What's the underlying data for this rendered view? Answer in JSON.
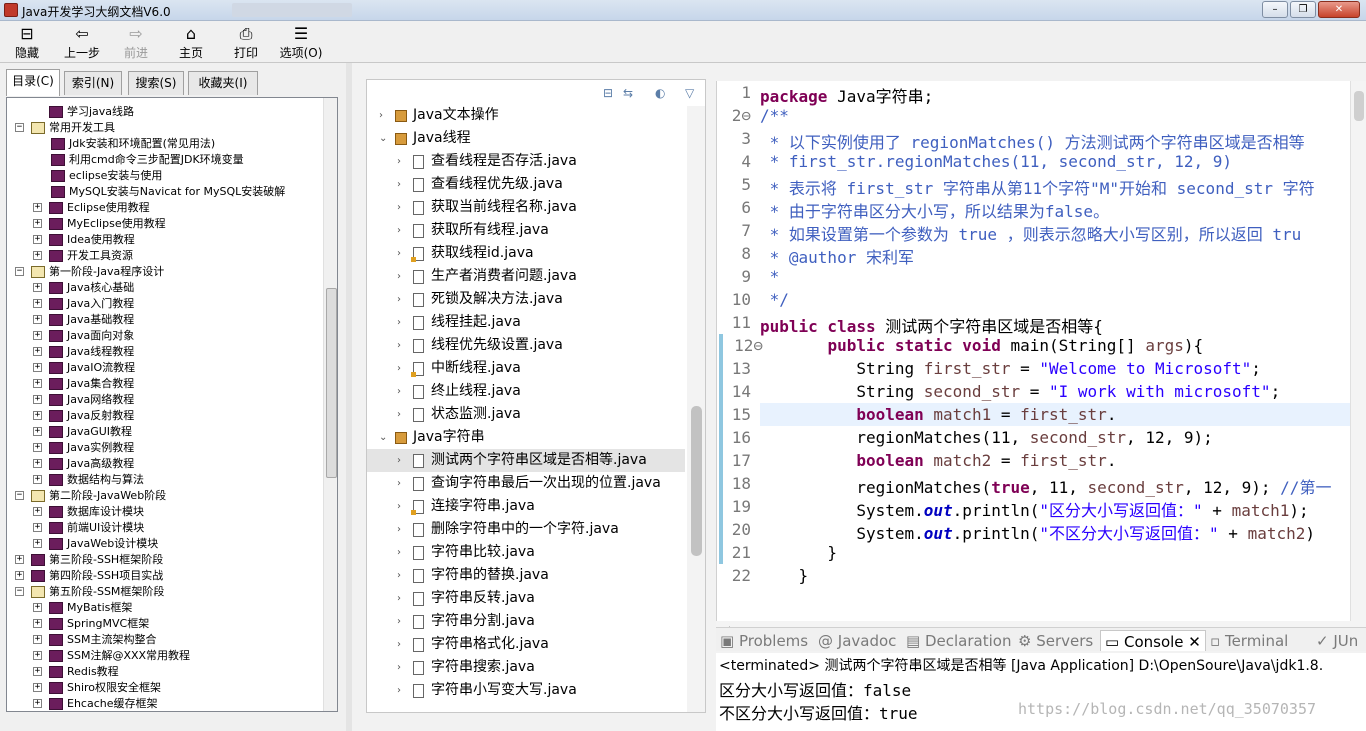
{
  "window": {
    "title": "Java开发学习大纲文档V6.0",
    "controls": [
      "–",
      "❐",
      "✕"
    ]
  },
  "toolbar": {
    "hide": "隐藏",
    "back": "上一步",
    "forward": "前进",
    "home": "主页",
    "print": "打印",
    "options": "选项(O)"
  },
  "left_tabs": [
    "目录(C)",
    "索引(N)",
    "搜索(S)",
    "收藏夹(I)"
  ],
  "toc": [
    {
      "label": "学习java线路",
      "level": 1,
      "expander": "",
      "icon": "closed"
    },
    {
      "label": "常用开发工具",
      "level": 0,
      "expander": "−",
      "icon": "open"
    },
    {
      "label": "Jdk安装和环境配置(常见用法)",
      "level": 2,
      "expander": "",
      "icon": "closed"
    },
    {
      "label": "利用cmd命令三步配置JDK环境变量",
      "level": 2,
      "expander": "",
      "icon": "closed"
    },
    {
      "label": "eclipse安装与使用",
      "level": 2,
      "expander": "",
      "icon": "closed"
    },
    {
      "label": "MySQL安装与Navicat for MySQL安装破解",
      "level": 2,
      "expander": "",
      "icon": "closed"
    },
    {
      "label": "Eclipse使用教程",
      "level": 1,
      "expander": "+",
      "icon": "closed"
    },
    {
      "label": "MyEclipse使用教程",
      "level": 1,
      "expander": "+",
      "icon": "closed"
    },
    {
      "label": "Idea使用教程",
      "level": 1,
      "expander": "+",
      "icon": "closed"
    },
    {
      "label": "开发工具资源",
      "level": 1,
      "expander": "+",
      "icon": "closed"
    },
    {
      "label": "第一阶段-Java程序设计",
      "level": 0,
      "expander": "−",
      "icon": "open"
    },
    {
      "label": "Java核心基础",
      "level": 1,
      "expander": "+",
      "icon": "closed"
    },
    {
      "label": "Java入门教程",
      "level": 1,
      "expander": "+",
      "icon": "closed"
    },
    {
      "label": "Java基础教程",
      "level": 1,
      "expander": "+",
      "icon": "closed"
    },
    {
      "label": "Java面向对象",
      "level": 1,
      "expander": "+",
      "icon": "closed"
    },
    {
      "label": "Java线程教程",
      "level": 1,
      "expander": "+",
      "icon": "closed"
    },
    {
      "label": "JavaIO流教程",
      "level": 1,
      "expander": "+",
      "icon": "closed"
    },
    {
      "label": "Java集合教程",
      "level": 1,
      "expander": "+",
      "icon": "closed"
    },
    {
      "label": "Java网络教程",
      "level": 1,
      "expander": "+",
      "icon": "closed"
    },
    {
      "label": "Java反射教程",
      "level": 1,
      "expander": "+",
      "icon": "closed"
    },
    {
      "label": "JavaGUI教程",
      "level": 1,
      "expander": "+",
      "icon": "closed"
    },
    {
      "label": "Java实例教程",
      "level": 1,
      "expander": "+",
      "icon": "closed"
    },
    {
      "label": "Java高级教程",
      "level": 1,
      "expander": "+",
      "icon": "closed"
    },
    {
      "label": "数据结构与算法",
      "level": 1,
      "expander": "+",
      "icon": "closed"
    },
    {
      "label": "第二阶段-JavaWeb阶段",
      "level": 0,
      "expander": "−",
      "icon": "open"
    },
    {
      "label": "数据库设计模块",
      "level": 1,
      "expander": "+",
      "icon": "closed"
    },
    {
      "label": "前端UI设计模块",
      "level": 1,
      "expander": "+",
      "icon": "closed"
    },
    {
      "label": "JavaWeb设计模块",
      "level": 1,
      "expander": "+",
      "icon": "closed"
    },
    {
      "label": "第三阶段-SSH框架阶段",
      "level": 0,
      "expander": "+",
      "icon": "closed"
    },
    {
      "label": "第四阶段-SSH项目实战",
      "level": 0,
      "expander": "+",
      "icon": "closed"
    },
    {
      "label": "第五阶段-SSM框架阶段",
      "level": 0,
      "expander": "−",
      "icon": "open"
    },
    {
      "label": "MyBatis框架",
      "level": 1,
      "expander": "+",
      "icon": "closed"
    },
    {
      "label": "SpringMVC框架",
      "level": 1,
      "expander": "+",
      "icon": "closed"
    },
    {
      "label": "SSM主流架构整合",
      "level": 1,
      "expander": "+",
      "icon": "closed"
    },
    {
      "label": "SSM注解@XXX常用教程",
      "level": 1,
      "expander": "+",
      "icon": "closed"
    },
    {
      "label": "Redis教程",
      "level": 1,
      "expander": "+",
      "icon": "closed"
    },
    {
      "label": "Shiro权限安全框架",
      "level": 1,
      "expander": "+",
      "icon": "closed"
    },
    {
      "label": "Ehcache缓存框架",
      "level": 1,
      "expander": "+",
      "icon": "closed"
    }
  ],
  "package_explorer": [
    {
      "label": "Java文本操作",
      "type": "package",
      "indent": 0,
      "arrow": "›"
    },
    {
      "label": "Java线程",
      "type": "package",
      "indent": 0,
      "arrow": "⌄"
    },
    {
      "label": "查看线程是否存活.java",
      "type": "file",
      "indent": 1,
      "arrow": "›"
    },
    {
      "label": "查看线程优先级.java",
      "type": "file",
      "indent": 1,
      "arrow": "›"
    },
    {
      "label": "获取当前线程名称.java",
      "type": "file",
      "indent": 1,
      "arrow": "›"
    },
    {
      "label": "获取所有线程.java",
      "type": "file",
      "indent": 1,
      "arrow": "›"
    },
    {
      "label": "获取线程id.java",
      "type": "file-warn",
      "indent": 1,
      "arrow": "›"
    },
    {
      "label": "生产者消费者问题.java",
      "type": "file",
      "indent": 1,
      "arrow": "›"
    },
    {
      "label": "死锁及解决方法.java",
      "type": "file",
      "indent": 1,
      "arrow": "›"
    },
    {
      "label": "线程挂起.java",
      "type": "file",
      "indent": 1,
      "arrow": "›"
    },
    {
      "label": "线程优先级设置.java",
      "type": "file",
      "indent": 1,
      "arrow": "›"
    },
    {
      "label": "中断线程.java",
      "type": "file-warn",
      "indent": 1,
      "arrow": "›"
    },
    {
      "label": "终止线程.java",
      "type": "file",
      "indent": 1,
      "arrow": "›"
    },
    {
      "label": "状态监测.java",
      "type": "file",
      "indent": 1,
      "arrow": "›"
    },
    {
      "label": "Java字符串",
      "type": "package",
      "indent": 0,
      "arrow": "⌄"
    },
    {
      "label": "测试两个字符串区域是否相等.java",
      "type": "file",
      "indent": 1,
      "arrow": "›",
      "selected": true
    },
    {
      "label": "查询字符串最后一次出现的位置.java",
      "type": "file",
      "indent": 1,
      "arrow": "›"
    },
    {
      "label": "连接字符串.java",
      "type": "file-warn",
      "indent": 1,
      "arrow": "›"
    },
    {
      "label": "删除字符串中的一个字符.java",
      "type": "file",
      "indent": 1,
      "arrow": "›"
    },
    {
      "label": "字符串比较.java",
      "type": "file",
      "indent": 1,
      "arrow": "›"
    },
    {
      "label": "字符串的替换.java",
      "type": "file",
      "indent": 1,
      "arrow": "›"
    },
    {
      "label": "字符串反转.java",
      "type": "file",
      "indent": 1,
      "arrow": "›"
    },
    {
      "label": "字符串分割.java",
      "type": "file",
      "indent": 1,
      "arrow": "›"
    },
    {
      "label": "字符串格式化.java",
      "type": "file",
      "indent": 1,
      "arrow": "›"
    },
    {
      "label": "字符串搜索.java",
      "type": "file",
      "indent": 1,
      "arrow": "›"
    },
    {
      "label": "字符串小写变大写.java",
      "type": "file",
      "indent": 1,
      "arrow": "›"
    }
  ],
  "code_lines": [
    {
      "n": "1",
      "segs": [
        {
          "c": "kw",
          "t": "package"
        },
        {
          "c": "",
          "t": " Java字符串;"
        }
      ]
    },
    {
      "n": "2⊖",
      "segs": [
        {
          "c": "cm",
          "t": "/**"
        }
      ]
    },
    {
      "n": "3",
      "segs": [
        {
          "c": "cm",
          "t": " * 以下实例使用了 regionMatches() 方法测试两个字符串区域是否相等"
        }
      ]
    },
    {
      "n": "4",
      "segs": [
        {
          "c": "cm",
          "t": " * first_str.regionMatches(11, second_str, 12, 9)"
        }
      ]
    },
    {
      "n": "5",
      "segs": [
        {
          "c": "cm",
          "t": " * 表示将 first_str 字符串从第11个字符\"M\"开始和 second_str 字符"
        }
      ]
    },
    {
      "n": "6",
      "segs": [
        {
          "c": "cm",
          "t": " * 由于字符串区分大小写，所以结果为false。"
        }
      ]
    },
    {
      "n": "7",
      "segs": [
        {
          "c": "cm",
          "t": " * 如果设置第一个参数为 true ，则表示忽略大小写区别，所以返回 tru"
        }
      ]
    },
    {
      "n": "8",
      "segs": [
        {
          "c": "cm",
          "t": " * @author 宋利军"
        }
      ]
    },
    {
      "n": "9",
      "segs": [
        {
          "c": "cm",
          "t": " *"
        }
      ]
    },
    {
      "n": "10",
      "segs": [
        {
          "c": "cm",
          "t": " */"
        }
      ]
    },
    {
      "n": "11",
      "segs": [
        {
          "c": "kw",
          "t": "public class"
        },
        {
          "c": "",
          "t": " 测试两个字符串区域是否相等{"
        }
      ]
    },
    {
      "n": "12⊖",
      "segs": [
        {
          "c": "",
          "t": "       "
        },
        {
          "c": "kw",
          "t": "public static void"
        },
        {
          "c": "",
          "t": " main(String[] "
        },
        {
          "c": "vr",
          "t": "args"
        },
        {
          "c": "",
          "t": "){"
        }
      ]
    },
    {
      "n": "13",
      "segs": [
        {
          "c": "",
          "t": "          String "
        },
        {
          "c": "vr",
          "t": "first_str"
        },
        {
          "c": "",
          "t": " = "
        },
        {
          "c": "st",
          "t": "\"Welcome to Microsoft\""
        },
        {
          "c": "",
          "t": ";"
        }
      ]
    },
    {
      "n": "14",
      "segs": [
        {
          "c": "",
          "t": "          String "
        },
        {
          "c": "vr",
          "t": "second_str"
        },
        {
          "c": "",
          "t": " = "
        },
        {
          "c": "st",
          "t": "\"I work with microsoft\""
        },
        {
          "c": "",
          "t": ";"
        }
      ]
    },
    {
      "n": "15",
      "segs": [
        {
          "c": "",
          "t": "          "
        },
        {
          "c": "kw",
          "t": "boolean"
        },
        {
          "c": "",
          "t": " "
        },
        {
          "c": "vr",
          "t": "match1"
        },
        {
          "c": "",
          "t": " = "
        },
        {
          "c": "vr",
          "t": "first_str"
        },
        {
          "c": "",
          "t": "."
        }
      ]
    },
    {
      "n": "16",
      "segs": [
        {
          "c": "",
          "t": "          regionMatches(11, "
        },
        {
          "c": "vr",
          "t": "second_str"
        },
        {
          "c": "",
          "t": ", 12, 9);"
        }
      ]
    },
    {
      "n": "17",
      "segs": [
        {
          "c": "",
          "t": "          "
        },
        {
          "c": "kw",
          "t": "boolean"
        },
        {
          "c": "",
          "t": " "
        },
        {
          "c": "vr",
          "t": "match2"
        },
        {
          "c": "",
          "t": " = "
        },
        {
          "c": "vr",
          "t": "first_str"
        },
        {
          "c": "",
          "t": "."
        }
      ]
    },
    {
      "n": "18",
      "segs": [
        {
          "c": "",
          "t": "          regionMatches("
        },
        {
          "c": "kw",
          "t": "true"
        },
        {
          "c": "",
          "t": ", 11, "
        },
        {
          "c": "vr",
          "t": "second_str"
        },
        {
          "c": "",
          "t": ", 12, 9); "
        },
        {
          "c": "cm",
          "t": "//第一"
        }
      ]
    },
    {
      "n": "19",
      "segs": [
        {
          "c": "",
          "t": "          System."
        },
        {
          "c": "fd",
          "t": "out"
        },
        {
          "c": "",
          "t": ".println("
        },
        {
          "c": "st",
          "t": "\"区分大小写返回值：\""
        },
        {
          "c": "",
          "t": " + "
        },
        {
          "c": "vr",
          "t": "match1"
        },
        {
          "c": "",
          "t": ");"
        }
      ]
    },
    {
      "n": "20",
      "segs": [
        {
          "c": "",
          "t": "          System."
        },
        {
          "c": "fd",
          "t": "out"
        },
        {
          "c": "",
          "t": ".println("
        },
        {
          "c": "st",
          "t": "\"不区分大小写返回值：\""
        },
        {
          "c": "",
          "t": " + "
        },
        {
          "c": "vr",
          "t": "match2"
        },
        {
          "c": "",
          "t": ")"
        }
      ]
    },
    {
      "n": "21",
      "segs": [
        {
          "c": "",
          "t": "       }"
        }
      ]
    },
    {
      "n": "22",
      "segs": [
        {
          "c": "",
          "t": "    }"
        }
      ]
    }
  ],
  "console_tabs": [
    "Problems",
    "@ Javadoc",
    "Declaration",
    "Servers",
    "Console ✕",
    "Terminal",
    "JUn"
  ],
  "console": {
    "terminated": "<terminated> 测试两个字符串区域是否相等 [Java Application] D:\\OpenSoure\\Java\\jdk1.8.",
    "output": [
      "区分大小写返回值：false",
      "不区分大小写返回值：true"
    ]
  },
  "watermark": "https://blog.csdn.net/qq_35070357"
}
